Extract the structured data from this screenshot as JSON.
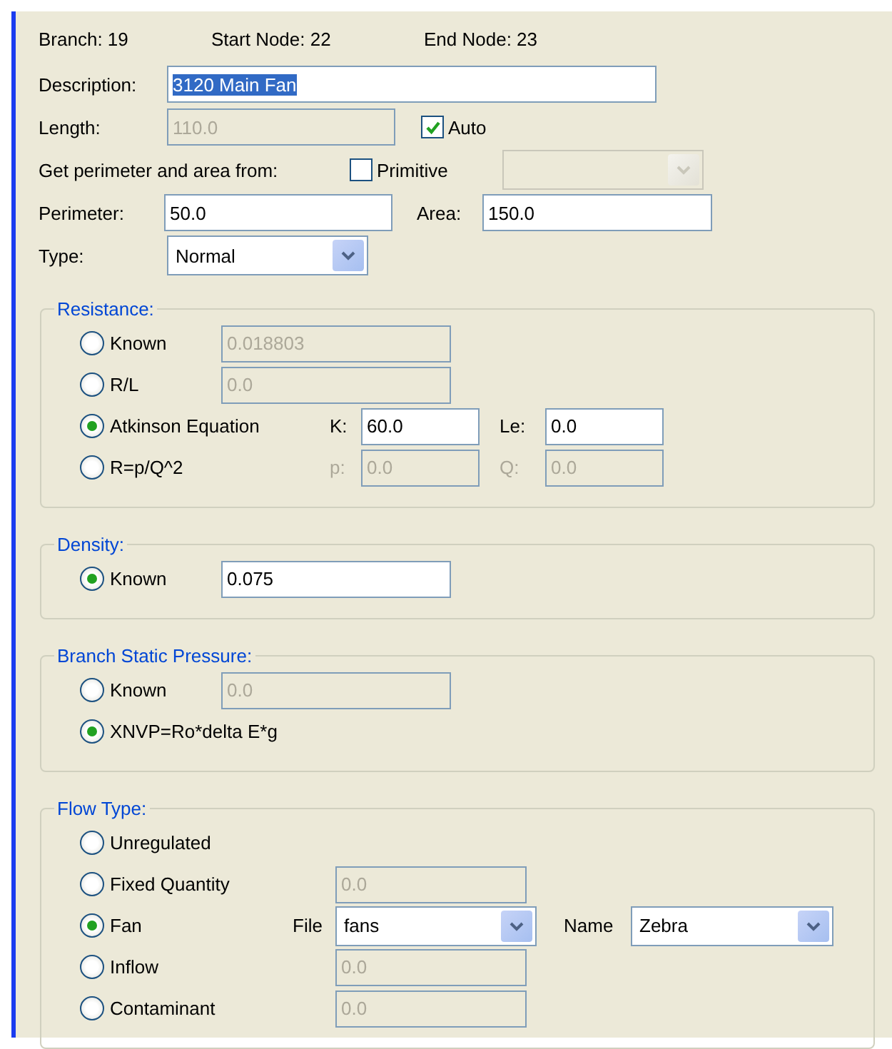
{
  "header": [
    "Branch: 19",
    "Start Node: 22",
    "End Node: 23"
  ],
  "description": {
    "label": "Description:",
    "value": "3120 Main Fan",
    "highlighted": true
  },
  "length": {
    "label": "Length:",
    "value": "110.0",
    "disabled": true
  },
  "auto": {
    "label": "Auto",
    "checked": true
  },
  "perimeter_source": {
    "label": "Get perimeter and area from:",
    "primitive": {
      "label": "Primitive",
      "checked": false
    },
    "primitive_select": {
      "disabled": true
    }
  },
  "perimeter": {
    "label": "Perimeter:",
    "value": "50.0",
    "disabled": false
  },
  "area": {
    "label": "Area:",
    "value": "150.0",
    "disabled": false
  },
  "type": {
    "label": "Type:",
    "value": "Normal",
    "disabled": false
  },
  "groups": [
    {
      "title": "Resistance:",
      "options": [
        {
          "label": "Known",
          "selected": false,
          "fields": [
            {
              "kind": "text",
              "value": "0.018803",
              "disabled": true
            }
          ]
        },
        {
          "label": "R/L",
          "selected": false,
          "fields": [
            {
              "kind": "text",
              "value": "0.0",
              "disabled": true
            }
          ]
        },
        {
          "label": "Atkinson Equation",
          "selected": true,
          "fields": [
            {
              "kind": "text",
              "label": "K:",
              "value": "60.0",
              "disabled": false
            },
            {
              "kind": "text",
              "label": "Le:",
              "value": "0.0",
              "disabled": false
            }
          ]
        },
        {
          "label": "R=p/Q^2",
          "selected": false,
          "fields": [
            {
              "kind": "text",
              "label": "p:",
              "value": "0.0",
              "disabled": true
            },
            {
              "kind": "text",
              "label": "Q:",
              "value": "0.0",
              "disabled": true
            }
          ]
        }
      ]
    },
    {
      "title": "Density:",
      "options": [
        {
          "label": "Known",
          "selected": true,
          "fields": [
            {
              "kind": "text",
              "value": "0.075",
              "disabled": false
            }
          ]
        }
      ]
    },
    {
      "title": "Branch Static Pressure:",
      "options": [
        {
          "label": "Known",
          "selected": false,
          "fields": [
            {
              "kind": "text",
              "value": "0.0",
              "disabled": true
            }
          ]
        },
        {
          "label": "XNVP=Ro*delta E*g",
          "selected": true
        }
      ]
    },
    {
      "title": "Flow Type:",
      "options": [
        {
          "label": "Unregulated",
          "selected": false
        },
        {
          "label": "Fixed Quantity",
          "selected": false,
          "fields": [
            {
              "kind": "text",
              "value": "0.0",
              "disabled": true
            }
          ]
        },
        {
          "label": "Fan",
          "selected": true,
          "fields": [
            {
              "kind": "select",
              "label": "File",
              "value": "fans",
              "disabled": false
            },
            {
              "kind": "select",
              "label": "Name",
              "value": "Zebra",
              "disabled": false
            }
          ]
        },
        {
          "label": "Inflow",
          "selected": false,
          "fields": [
            {
              "kind": "text",
              "value": "0.0",
              "disabled": true
            }
          ]
        },
        {
          "label": "Contaminant",
          "selected": false,
          "fields": [
            {
              "kind": "text",
              "value": "0.0",
              "disabled": true
            }
          ]
        }
      ]
    }
  ]
}
